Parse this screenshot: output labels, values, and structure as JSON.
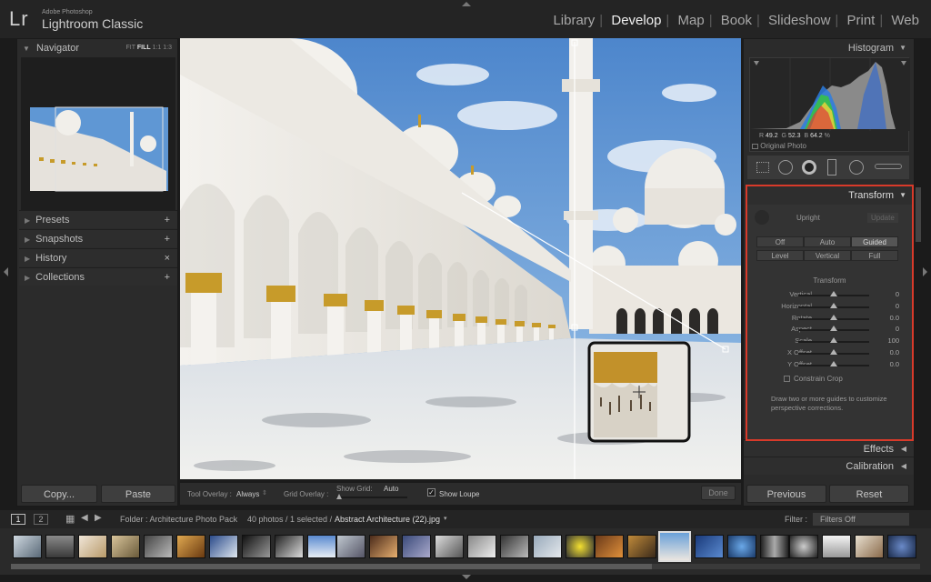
{
  "app": {
    "logo": "Lr",
    "brand_small": "Adobe Photoshop",
    "brand_big": "Lightroom Classic"
  },
  "modules": [
    "Library",
    "Develop",
    "Map",
    "Book",
    "Slideshow",
    "Print",
    "Web"
  ],
  "active_module": "Develop",
  "left_panel": {
    "navigator": {
      "title": "Navigator",
      "zoom": [
        "FIT",
        "FILL",
        "1:1",
        "1:3"
      ],
      "active_zoom": "FILL"
    },
    "sections": [
      {
        "label": "Presets",
        "action": "+"
      },
      {
        "label": "Snapshots",
        "action": "+"
      },
      {
        "label": "History",
        "action": "×"
      },
      {
        "label": "Collections",
        "action": "+"
      }
    ],
    "copy": "Copy...",
    "paste": "Paste"
  },
  "toolbar": {
    "tool_overlay_label": "Tool Overlay :",
    "tool_overlay_value": "Always",
    "grid_overlay_label": "Grid Overlay :",
    "show_grid_label": "Show Grid:",
    "show_grid_value": "Auto",
    "show_loupe": "Show Loupe",
    "show_loupe_checked": true,
    "done": "Done"
  },
  "right_panel": {
    "histogram_title": "Histogram",
    "readout": {
      "r_label": "R",
      "r": "49.2",
      "g_label": "G",
      "g": "52.3",
      "b_label": "B",
      "b": "64.2",
      "unit": "%"
    },
    "original_photo": "Original Photo",
    "transform": {
      "title": "Transform",
      "upright_label": "Upright",
      "update_label": "Update",
      "upright_modes": [
        "Off",
        "Auto",
        "Guided",
        "Level",
        "Vertical",
        "Full"
      ],
      "active_mode": "Guided",
      "section_label": "Transform",
      "sliders": [
        {
          "label": "Vertical",
          "value": "0",
          "pos": 0.5
        },
        {
          "label": "Horizontal",
          "value": "0",
          "pos": 0.5
        },
        {
          "label": "Rotate",
          "value": "0.0",
          "pos": 0.5
        },
        {
          "label": "Aspect",
          "value": "0",
          "pos": 0.5
        },
        {
          "label": "Scale",
          "value": "100",
          "pos": 0.5
        },
        {
          "label": "X Offset",
          "value": "0.0",
          "pos": 0.5
        },
        {
          "label": "Y Offset",
          "value": "0.0",
          "pos": 0.5
        }
      ],
      "constrain_crop": "Constrain Crop",
      "hint": "Draw two or more guides to customize perspective corrections."
    },
    "effects": "Effects",
    "calibration": "Calibration",
    "previous": "Previous",
    "reset": "Reset"
  },
  "filmbar": {
    "screen1": "1",
    "screen2": "2",
    "folder": "Folder : Architecture Photo Pack",
    "count": "40 photos / 1 selected /",
    "filename": "Abstract Architecture (22).jpg",
    "filter_label": "Filter :",
    "filter_value": "Filters Off"
  },
  "colors": {
    "accent_red": "#d83a2a",
    "sky": "#5f97d4",
    "marble": "#e9e6e0",
    "gold": "#c79b2a"
  }
}
